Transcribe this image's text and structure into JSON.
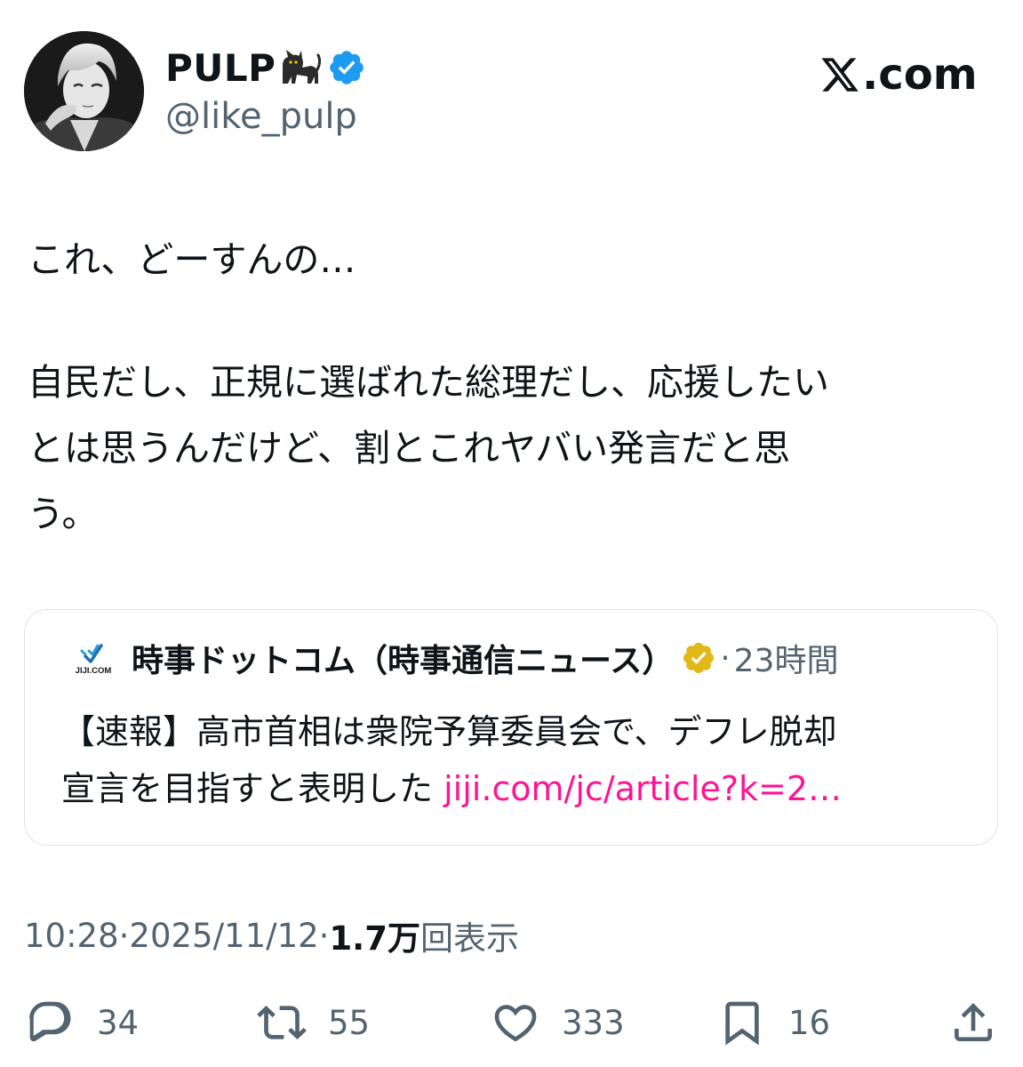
{
  "author": {
    "display_name": "PULP",
    "handle": "@like_pulp",
    "verified_color": "#1d9bf0"
  },
  "brand": {
    "text": ".com",
    "logo": "x-logo-icon"
  },
  "tweet": {
    "lines": [
      "これ、どーすんの…",
      "自民だし、正規に選ばれた総理だし、応援したい",
      "とは思うんだけど、割とこれヤバい発言だと思",
      "う。"
    ]
  },
  "quote": {
    "logo": "jiji-com-logo",
    "logo_text": "JIJI.COM",
    "author": "時事ドットコム（時事通信ニュース）",
    "badge_color": "#e2b719",
    "separator": "·",
    "time": "23時間",
    "body_line1": "【速報】高市首相は衆院予算委員会で、デフレ脱却",
    "body_line2": "宣言を目指すと表明した ",
    "link": "jiji.com/jc/article?k=2…",
    "link_color": "#ff1493"
  },
  "meta": {
    "time": "10:28",
    "sep1": " · ",
    "date": "2025/11/12",
    "sep2": " · ",
    "views": "1.7万",
    "views_label": "回表示"
  },
  "actions": {
    "replies": "34",
    "retweets": "55",
    "likes": "333",
    "bookmarks": "16"
  }
}
